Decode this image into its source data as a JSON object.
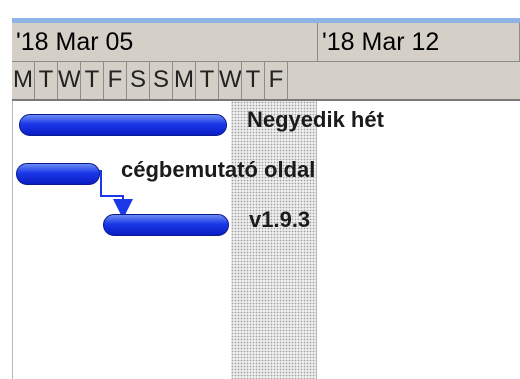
{
  "timeline": {
    "weeks": [
      "'18 Mar 05",
      "'18 Mar 12"
    ],
    "days": [
      "M",
      "T",
      "W",
      "T",
      "F",
      "S",
      "S",
      "M",
      "T",
      "W",
      "T",
      "F"
    ]
  },
  "tasks": [
    {
      "label": "Negyedik hét"
    },
    {
      "label": "cégbemutató oldal"
    },
    {
      "label": "v1.9.3"
    }
  ],
  "colors": {
    "bar": "#1b38e8",
    "header": "#d4d0c8",
    "weekend": "#eeeeee"
  }
}
